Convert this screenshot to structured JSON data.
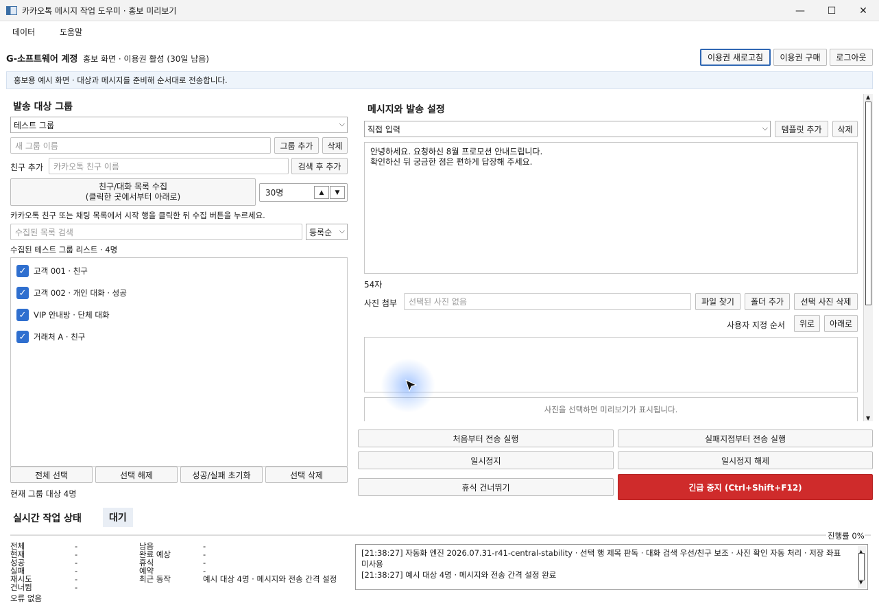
{
  "window": {
    "title": "카카오톡 메시지 작업 도우미 · 홍보 미리보기",
    "minimize": "—",
    "maximize": "☐",
    "close": "✕"
  },
  "menu": {
    "data": "데이터",
    "help": "도움말"
  },
  "account": {
    "name": "G-소프트웨어 계정",
    "status": "홍보 화면 · 이용권 활성 (30일 남음)",
    "refresh_label": "이용권 새로고침",
    "buy_label": "이용권 구매",
    "logout_label": "로그아웃"
  },
  "notice": "홍보용 예시 화면 · 대상과 메시지를 준비해 순서대로 전송합니다.",
  "left": {
    "heading": "발송 대상 그룹",
    "group_select": "테스트 그룹",
    "new_group_placeholder": "새 그룹 이름",
    "add_group_label": "그룹 추가",
    "delete_group_label": "삭제",
    "add_friend_label": "친구 추가",
    "friend_placeholder": "카카오톡 친구 이름",
    "search_add_label": "검색 후 추가",
    "collect_line1": "친구/대화 목록 수집",
    "collect_line2": "(클릭한 곳에서부터 아래로)",
    "count_value": "30명",
    "hint": "카카오톡 친구 또는 채팅 목록에서 시작 행을 클릭한 뒤 수집 버튼을 누르세요.",
    "filter_placeholder": "수집된 목록 검색",
    "sort_value": "등록순",
    "list_title": "수집된 테스트 그룹 리스트 · 4명",
    "items": [
      "고객 001 · 친구",
      "고객 002 · 개인 대화 · 성공",
      "VIP 안내방 · 단체 대화",
      "거래처 A · 친구"
    ],
    "select_all": "전체 선택",
    "deselect": "선택 해제",
    "reset_result": "성공/실패 초기화",
    "delete_selected": "선택 삭제",
    "current_count": "현재 그룹 대상 4명"
  },
  "right": {
    "heading": "메시지와 발송 설정",
    "template_select": "직접 입력",
    "add_template": "템플릿 추가",
    "delete_template": "삭제",
    "message_line1": "안녕하세요. 요청하신 8월 프로모션 안내드립니다.",
    "message_line2": "확인하신 뒤 궁금한 점은 편하게 답장해 주세요.",
    "char_count": "54자",
    "photo_label": "사진 첨부",
    "photo_placeholder": "선택된 사진 없음",
    "find_file": "파일 찾기",
    "add_folder": "폴더 추가",
    "delete_photo": "선택 사진 삭제",
    "order_label": "사용자 지정 순서",
    "up": "위로",
    "down": "아래로",
    "preview_text": "사진을 선택하면 미리보기가 표시됩니다."
  },
  "actions": {
    "run_start": "처음부터 전송 실행",
    "run_failed": "실패지점부터 전송 실행",
    "pause": "일시정지",
    "resume": "일시정지 해제",
    "skip_rest": "휴식 건너뛰기",
    "emergency": "긴급 중지 (Ctrl+Shift+F12)"
  },
  "status": {
    "heading": "실시간 작업 상태",
    "badge": "대기",
    "progress": "진행률 0%",
    "progress_value": 0,
    "col1": [
      {
        "k": "전체",
        "v": "-"
      },
      {
        "k": "현재",
        "v": "-"
      },
      {
        "k": "성공",
        "v": "-"
      },
      {
        "k": "실패",
        "v": "-"
      },
      {
        "k": "재시도",
        "v": "-"
      },
      {
        "k": "건너뜀",
        "v": "-"
      }
    ],
    "col2": [
      {
        "k": "남음",
        "v": "-"
      },
      {
        "k": "완료 예상",
        "v": "-"
      },
      {
        "k": "휴식",
        "v": "-"
      },
      {
        "k": "예약",
        "v": "-"
      },
      {
        "k": "최근 동작",
        "v": "예시 대상 4명 · 메시지와 전송 간격 설정"
      }
    ],
    "error": "오류 없음",
    "log1": "[21:38:27] 자동화 엔진 2026.07.31-r41-central-stability · 선택 행 제목 판독 · 대화 검색 우선/친구 보조 · 사진 확인 자동 처리 · 저장 좌표 미사용",
    "log2": "[21:38:27] 예시 대상 4명 · 메시지와 전송 간격 설정 완료"
  }
}
